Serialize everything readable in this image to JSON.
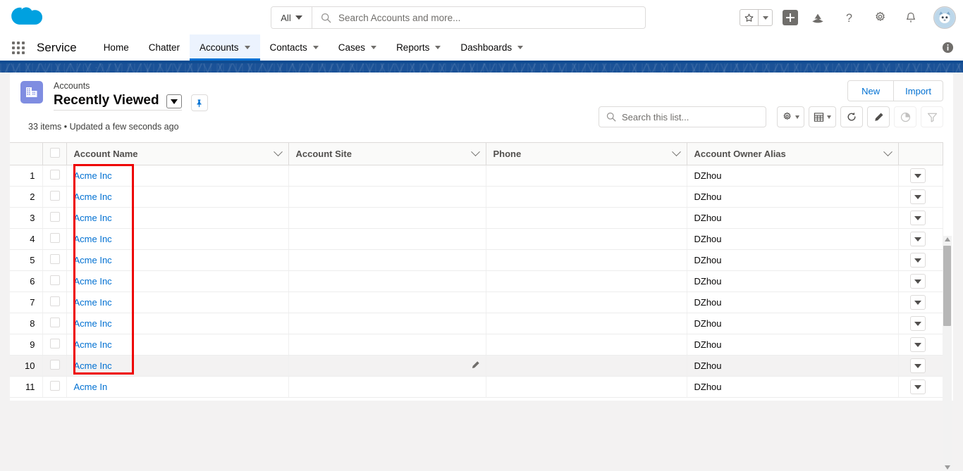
{
  "header": {
    "logo_icon": "salesforce-cloud-logo",
    "search": {
      "scope_label": "All",
      "scope_icon": "chevron-down-icon",
      "search_icon": "search-icon",
      "placeholder": "Search Accounts and more...",
      "value": ""
    },
    "actions": {
      "favorites_icon": "star-icon",
      "favorites_caret_icon": "chevron-down-icon",
      "add_icon": "plus-icon",
      "learning_icon": "trailhead-icon",
      "help_icon": "question-mark-icon",
      "setup_icon": "gear-icon",
      "notifications_icon": "bell-icon",
      "avatar_icon": "user-avatar"
    }
  },
  "nav": {
    "app_launcher_icon": "app-launcher-waffle-icon",
    "app_name": "Service",
    "items": [
      {
        "label": "Home",
        "has_menu": false,
        "active": false
      },
      {
        "label": "Chatter",
        "has_menu": false,
        "active": false
      },
      {
        "label": "Accounts",
        "has_menu": true,
        "active": true
      },
      {
        "label": "Contacts",
        "has_menu": true,
        "active": false
      },
      {
        "label": "Cases",
        "has_menu": true,
        "active": false
      },
      {
        "label": "Reports",
        "has_menu": true,
        "active": false
      },
      {
        "label": "Dashboards",
        "has_menu": true,
        "active": false
      }
    ],
    "info_icon": "info-icon"
  },
  "list_view": {
    "object_icon": "account-object-icon",
    "eyebrow": "Accounts",
    "title": "Recently Viewed",
    "title_dropdown_icon": "chevron-down-icon",
    "pin_icon": "pin-icon",
    "meta": "33 items • Updated a few seconds ago",
    "buttons": [
      {
        "label": "New"
      },
      {
        "label": "Import"
      }
    ],
    "search": {
      "icon": "search-icon",
      "placeholder": "Search this list...",
      "value": ""
    },
    "tools": [
      {
        "name": "list-view-controls",
        "icon": "gear-icon",
        "caret": true,
        "disabled": false
      },
      {
        "name": "display-as",
        "icon": "table-icon",
        "caret": true,
        "disabled": false
      },
      {
        "name": "refresh",
        "icon": "refresh-icon",
        "caret": false,
        "disabled": false
      },
      {
        "name": "edit-list",
        "icon": "pencil-icon",
        "caret": false,
        "disabled": false
      },
      {
        "name": "charts",
        "icon": "chart-icon",
        "caret": false,
        "disabled": true
      },
      {
        "name": "filters",
        "icon": "filter-icon",
        "caret": false,
        "disabled": true
      }
    ]
  },
  "table": {
    "columns": [
      {
        "key": "num",
        "label": "",
        "sortable": false
      },
      {
        "key": "chk",
        "label": "",
        "sortable": false
      },
      {
        "key": "name",
        "label": "Account Name",
        "sortable": true
      },
      {
        "key": "site",
        "label": "Account Site",
        "sortable": true
      },
      {
        "key": "phone",
        "label": "Phone",
        "sortable": true
      },
      {
        "key": "owner",
        "label": "Account Owner Alias",
        "sortable": true
      },
      {
        "key": "act",
        "label": "",
        "sortable": false
      }
    ],
    "select_all_icon": "checkbox-unchecked",
    "row_action_icon": "chevron-down-icon",
    "rows": [
      {
        "num": "1",
        "name": "Acme Inc",
        "site": "",
        "phone": "",
        "owner": "DZhou",
        "hovered": false
      },
      {
        "num": "2",
        "name": "Acme Inc",
        "site": "",
        "phone": "",
        "owner": "DZhou",
        "hovered": false
      },
      {
        "num": "3",
        "name": "Acme Inc",
        "site": "",
        "phone": "",
        "owner": "DZhou",
        "hovered": false
      },
      {
        "num": "4",
        "name": "Acme Inc",
        "site": "",
        "phone": "",
        "owner": "DZhou",
        "hovered": false
      },
      {
        "num": "5",
        "name": "Acme Inc",
        "site": "",
        "phone": "",
        "owner": "DZhou",
        "hovered": false
      },
      {
        "num": "6",
        "name": "Acme Inc",
        "site": "",
        "phone": "",
        "owner": "DZhou",
        "hovered": false
      },
      {
        "num": "7",
        "name": "Acme Inc",
        "site": "",
        "phone": "",
        "owner": "DZhou",
        "hovered": false
      },
      {
        "num": "8",
        "name": "Acme Inc",
        "site": "",
        "phone": "",
        "owner": "DZhou",
        "hovered": false
      },
      {
        "num": "9",
        "name": "Acme Inc",
        "site": "",
        "phone": "",
        "owner": "DZhou",
        "hovered": false
      },
      {
        "num": "10",
        "name": "Acme Inc",
        "site": "",
        "phone": "",
        "owner": "DZhou",
        "hovered": true
      },
      {
        "num": "11",
        "name": "Acme In",
        "site": "",
        "phone": "",
        "owner": "DZhou",
        "hovered": false
      }
    ]
  },
  "annotation": {
    "type": "highlight-rectangle",
    "color": "#ee0000",
    "target": "account-name-column-links"
  },
  "colors": {
    "link": "#0070d2",
    "theme_band": "#1b5297",
    "active_tab_bg": "#ecf3fe",
    "page_bg": "#f3f2f2",
    "object_icon_bg": "#7f8de1"
  }
}
